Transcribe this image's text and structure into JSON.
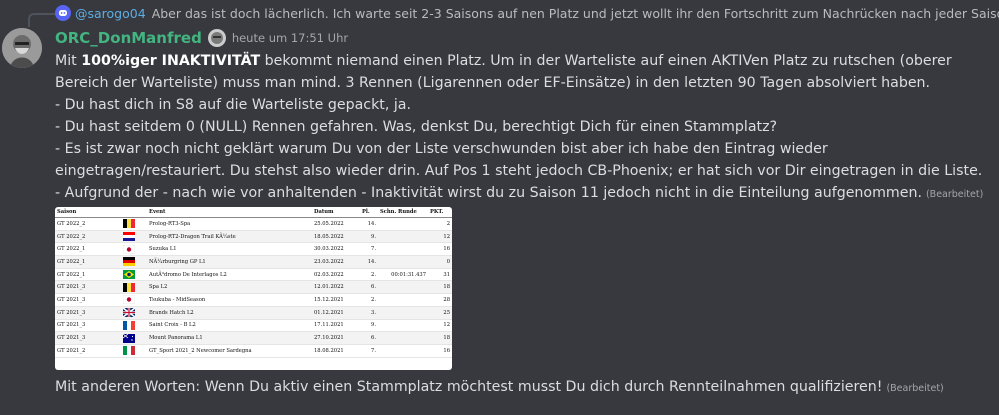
{
  "reply": {
    "author": "@sarogo04",
    "text": "Aber das ist doch lächerlich. Ich warte seit 2-3 Saisons auf nen Platz und jetzt wollt ihr den Fortschritt zum Nachrücken nach jeder Saison nul"
  },
  "message": {
    "author": "ORC_DonManfred",
    "timestamp": "heute um 17:51 Uhr",
    "author_color": "#43b581",
    "p1_pre": "Mit ",
    "p1_bold": "100%iger INAKTIVITÄT",
    "p1_post": " bekommt niemand einen Platz. Um in der Warteliste auf einen AKTIVen Platz zu rutschen (oberer Bereich der Warteliste) muss man mind. 3 Rennen (Ligarennen oder EF-Einsätze) in den letzten 90 Tagen absolviert haben.",
    "line2": "- Du hast dich in S8 auf die Warteliste gepackt, ja.",
    "line3": "- Du hast seitdem 0 (NULL) Rennen gefahren. Was, denkst Du, berechtigt Dich für einen Stammplatz?",
    "line4": "- Es ist zwar noch nicht geklärt warum Du von der Liste verschwunden bist aber ich habe den Eintrag wieder eingetragen/restauriert.  Du stehst also wieder drin. Auf Pos 1 steht jedoch CB-Phoenix; er hat sich vor Dir eingetragen in die Liste.",
    "line5": "- Aufgrund der - nach wie vor anhaltenden - Inaktivität wirst du zu Saison 11 jedoch nicht in die Einteilung aufgenommen.",
    "edited": "(Bearbeitet)",
    "last_line": "Mit anderen Worten: Wenn Du aktiv einen Stammplatz möchtest musst Du dich durch Rennteilnahmen qualifizieren!",
    "last_edited": "(Bearbeitet)"
  },
  "table": {
    "headers": [
      "Saison",
      "",
      "Event",
      "Datum",
      "Pl.",
      "Schn. Runde",
      "PKT."
    ],
    "rows": [
      {
        "saison": "GT 2022_2",
        "flag": "belgium",
        "event": "Prolog-RT3-Spa",
        "datum": "25.05.2022",
        "pl": "14.",
        "runde": "",
        "pkt": "2"
      },
      {
        "saison": "GT 2022_2",
        "flag": "croatia",
        "event": "Prolog-RT2-Dragon Trail KÃ¼ste",
        "datum": "18.05.2022",
        "pl": "9.",
        "runde": "",
        "pkt": "12"
      },
      {
        "saison": "GT 2022_1",
        "flag": "japan",
        "event": "Suzuka L1",
        "datum": "30.03.2022",
        "pl": "7.",
        "runde": "",
        "pkt": "16"
      },
      {
        "saison": "GT 2022_1",
        "flag": "germany",
        "event": "NÃ¼rburgring GP L1",
        "datum": "23.03.2022",
        "pl": "14.",
        "runde": "",
        "pkt": "0"
      },
      {
        "saison": "GT 2022_1",
        "flag": "brazil",
        "event": "AutÃ³dromo De Interlagos L2",
        "datum": "02.03.2022",
        "pl": "2.",
        "runde": "00:01:31.437",
        "pkt": "31"
      },
      {
        "saison": "GT 2021_3",
        "flag": "belgium",
        "event": "Spa L2",
        "datum": "12.01.2022",
        "pl": "6.",
        "runde": "",
        "pkt": "18"
      },
      {
        "saison": "GT 2021_3",
        "flag": "japan",
        "event": "Tsukuba - MidSeason",
        "datum": "15.12.2021",
        "pl": "2.",
        "runde": "",
        "pkt": "28"
      },
      {
        "saison": "GT 2021_3",
        "flag": "uk",
        "event": "Brands Hatch L2",
        "datum": "01.12.2021",
        "pl": "3.",
        "runde": "",
        "pkt": "25"
      },
      {
        "saison": "GT 2021_3",
        "flag": "france",
        "event": "Saint Croix - B L2",
        "datum": "17.11.2021",
        "pl": "9.",
        "runde": "",
        "pkt": "12"
      },
      {
        "saison": "GT 2021_3",
        "flag": "australia",
        "event": "Mount Panorama L1",
        "datum": "27.10.2021",
        "pl": "6.",
        "runde": "",
        "pkt": "18"
      },
      {
        "saison": "GT 2021_2",
        "flag": "italy",
        "event": "GT_Sport 2021_2 Newcomer Sardegna",
        "datum": "18.08.2021",
        "pl": "7.",
        "runde": "",
        "pkt": "16"
      }
    ]
  }
}
